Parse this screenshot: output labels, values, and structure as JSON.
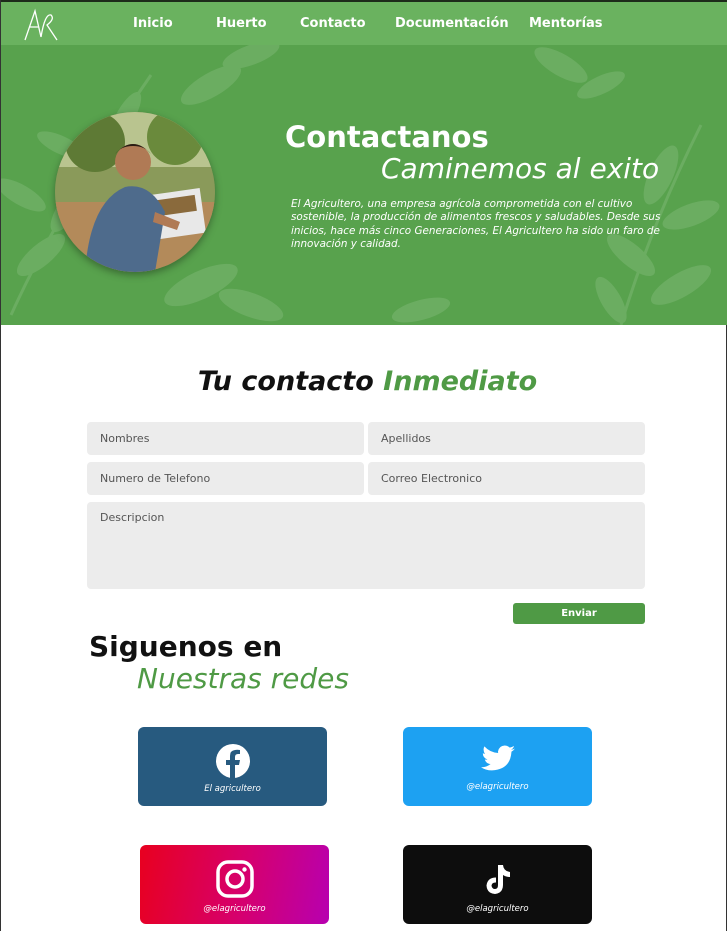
{
  "nav": {
    "logo": "AR",
    "items": [
      {
        "label": "Inicio"
      },
      {
        "label": "Huerto"
      },
      {
        "label": "Contacto"
      },
      {
        "label": "Documentación"
      },
      {
        "label": "Mentorías"
      }
    ]
  },
  "hero": {
    "title": "Contactanos",
    "subtitle": "Caminemos al exito",
    "description": "El Agricultero, una empresa agrícola comprometida con el cultivo sostenible, la producción de alimentos frescos y saludables. Desde sus inicios, hace más cinco Generaciones, El Agricultero ha sido un faro de innovación y calidad."
  },
  "contact": {
    "title_part1": "Tu contacto",
    "title_part2": "Inmediato",
    "fields": {
      "first_name": {
        "placeholder": "Nombres",
        "value": ""
      },
      "last_name": {
        "placeholder": "Apellidos",
        "value": ""
      },
      "phone": {
        "placeholder": "Numero de Telefono",
        "value": ""
      },
      "email": {
        "placeholder": "Correo Electronico",
        "value": ""
      },
      "description": {
        "placeholder": "Descripcion",
        "value": ""
      }
    },
    "submit_label": "Enviar"
  },
  "social": {
    "title_part1": "Siguenos en",
    "title_part2": "Nuestras redes",
    "cards": [
      {
        "network": "facebook",
        "icon": "facebook-icon",
        "handle": "El agricultero",
        "color": "#275a7f"
      },
      {
        "network": "twitter",
        "icon": "twitter-icon",
        "handle": "@elagricultero",
        "color": "#1da1f2"
      },
      {
        "network": "instagram",
        "icon": "instagram-icon",
        "handle": "@elagricultero",
        "color": "#e4002b"
      },
      {
        "network": "tiktok",
        "icon": "tiktok-icon",
        "handle": "@elagricultero",
        "color": "#0d0d0d"
      }
    ]
  },
  "colors": {
    "brand_green": "#4f9a45",
    "hero_green": "#58a24d",
    "nav_green": "#6ab25f"
  }
}
